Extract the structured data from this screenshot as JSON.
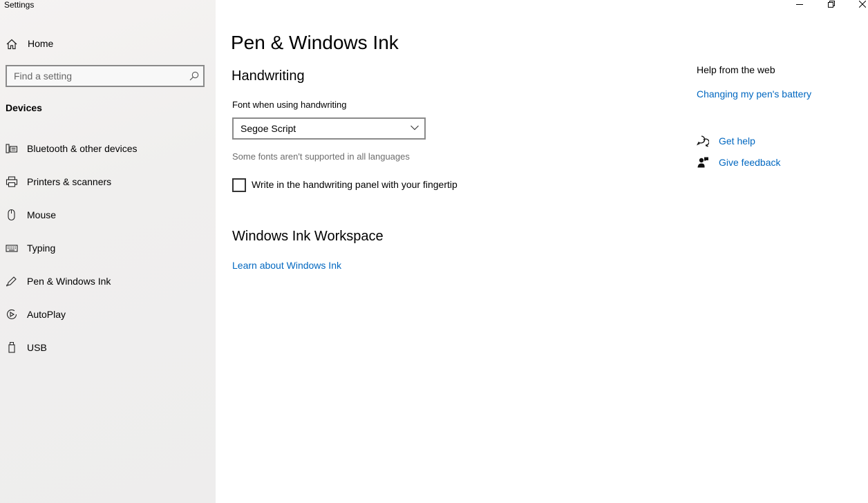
{
  "window": {
    "app_title": "Settings",
    "controls": {
      "minimize_icon": "minimize-icon",
      "restore_icon": "restore-icon",
      "close_icon": "close-icon"
    }
  },
  "sidebar": {
    "home_label": "Home",
    "search_placeholder": "Find a setting",
    "section_label": "Devices",
    "items": [
      {
        "label": "Bluetooth & other devices",
        "icon": "bluetooth-devices-icon"
      },
      {
        "label": "Printers & scanners",
        "icon": "printer-icon"
      },
      {
        "label": "Mouse",
        "icon": "mouse-icon"
      },
      {
        "label": "Typing",
        "icon": "keyboard-icon"
      },
      {
        "label": "Pen & Windows Ink",
        "icon": "pen-icon"
      },
      {
        "label": "AutoPlay",
        "icon": "autoplay-icon"
      },
      {
        "label": "USB",
        "icon": "usb-icon"
      }
    ]
  },
  "main": {
    "page_title": "Pen & Windows Ink",
    "handwriting": {
      "heading": "Handwriting",
      "font_label": "Font when using handwriting",
      "font_value": "Segoe Script",
      "note": "Some fonts aren't supported in all languages",
      "checkbox_label": "Write in the handwriting panel with your fingertip",
      "checkbox_checked": false
    },
    "ink_workspace": {
      "heading": "Windows Ink Workspace",
      "link": "Learn about Windows Ink"
    }
  },
  "help": {
    "title": "Help from the web",
    "web_link": "Changing my pen's battery",
    "get_help": "Get help",
    "give_feedback": "Give feedback"
  },
  "colors": {
    "link": "#0067c0",
    "sidebar_bg": "#f2f1f0",
    "note_text": "#6d6d6d"
  }
}
